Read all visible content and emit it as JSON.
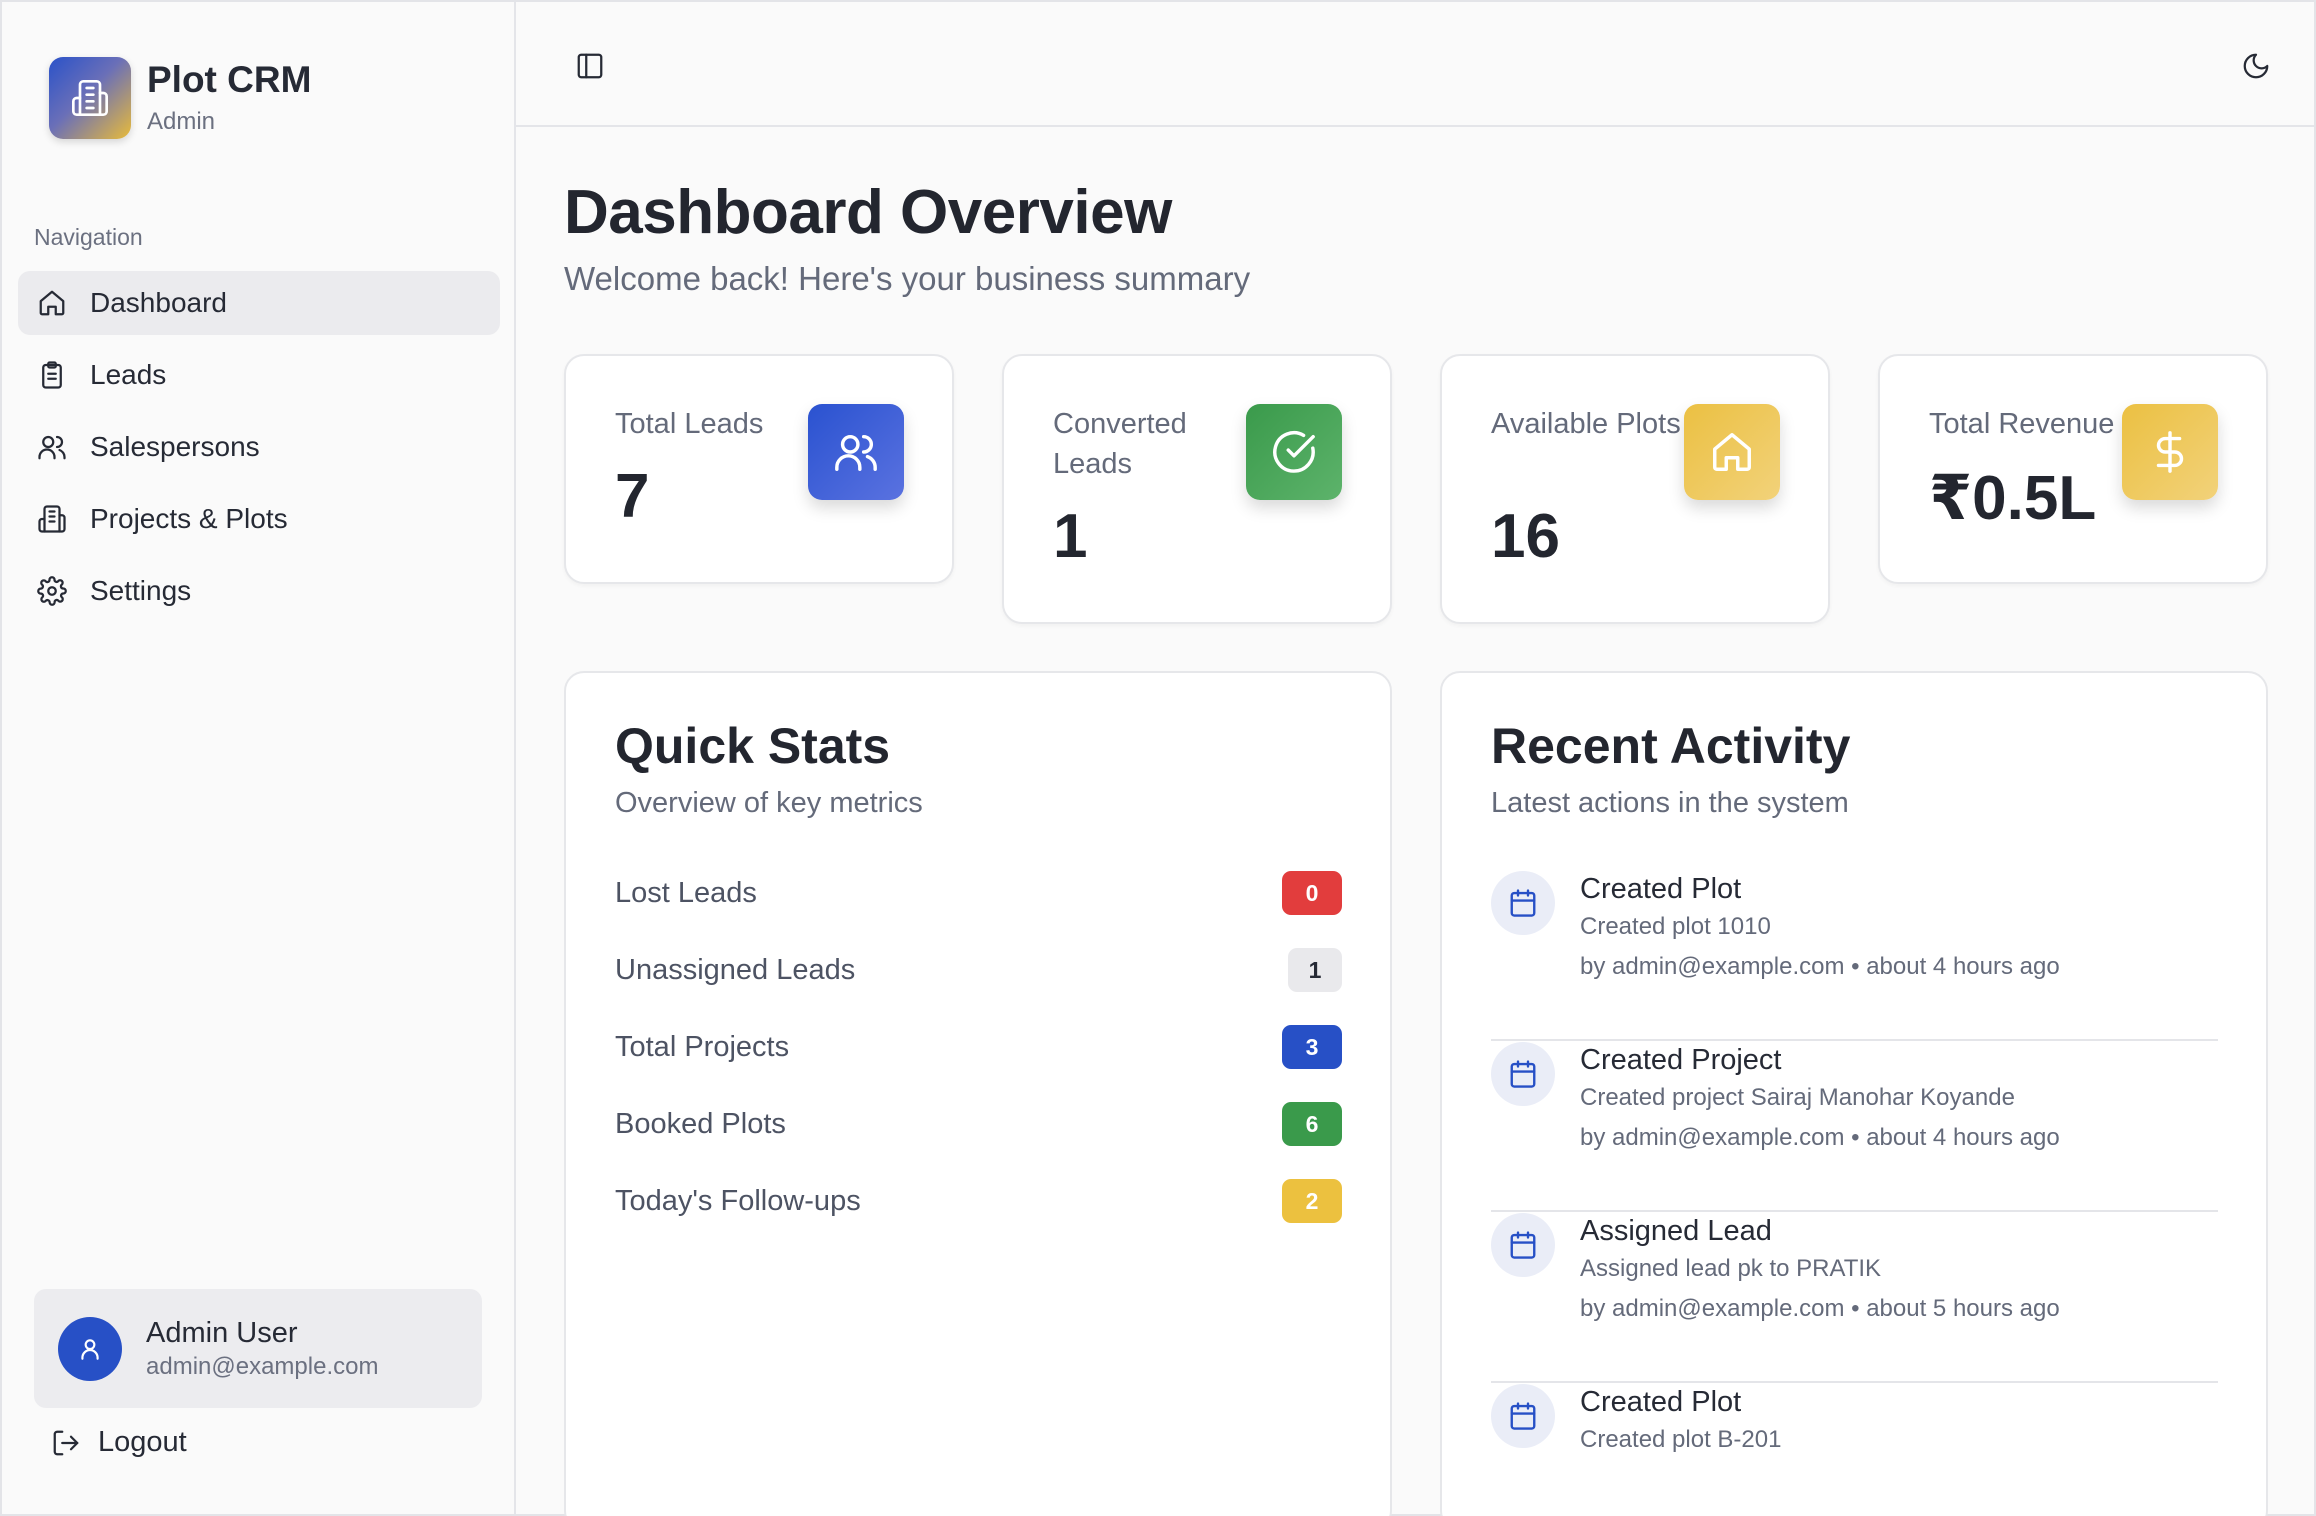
{
  "brand": {
    "title": "Plot CRM",
    "subtitle": "Admin"
  },
  "nav": {
    "heading": "Navigation",
    "items": [
      {
        "label": "Dashboard",
        "icon": "home-icon",
        "active": true
      },
      {
        "label": "Leads",
        "icon": "clipboard-icon",
        "active": false
      },
      {
        "label": "Salespersons",
        "icon": "users-icon",
        "active": false
      },
      {
        "label": "Projects & Plots",
        "icon": "building-icon",
        "active": false
      },
      {
        "label": "Settings",
        "icon": "gear-icon",
        "active": false
      }
    ]
  },
  "user": {
    "name": "Admin User",
    "email": "admin@example.com"
  },
  "logout_label": "Logout",
  "page": {
    "title": "Dashboard Overview",
    "subtitle": "Welcome back! Here's your business summary"
  },
  "stats": [
    {
      "label": "Total Leads",
      "value": "7",
      "icon": "users-icon",
      "color": "#3358d4"
    },
    {
      "label": "Converted Leads",
      "value": "1",
      "icon": "check-circle-icon",
      "color": "#3f9a4f"
    },
    {
      "label": "Available Plots",
      "value": "16",
      "icon": "home-icon",
      "color": "#edc24a"
    },
    {
      "label": "Total Revenue",
      "value": "₹0.5L",
      "icon": "dollar-icon",
      "color": "#edc24a"
    }
  ],
  "quick_stats": {
    "title": "Quick Stats",
    "subtitle": "Overview of key metrics",
    "rows": [
      {
        "label": "Lost Leads",
        "value": "0",
        "bg": "#e23d3d",
        "fg": "#ffffff"
      },
      {
        "label": "Unassigned Leads",
        "value": "1",
        "bg": "#e9e9ec",
        "fg": "#262a35"
      },
      {
        "label": "Total Projects",
        "value": "3",
        "bg": "#2750c6",
        "fg": "#ffffff"
      },
      {
        "label": "Booked Plots",
        "value": "6",
        "bg": "#3a9a4b",
        "fg": "#ffffff"
      },
      {
        "label": "Today's Follow-ups",
        "value": "2",
        "bg": "#ecc13f",
        "fg": "#ffffff"
      }
    ]
  },
  "recent_activity": {
    "title": "Recent Activity",
    "subtitle": "Latest actions in the system",
    "items": [
      {
        "title": "Created Plot",
        "desc": "Created plot 1010",
        "meta": "by admin@example.com • about 4 hours ago"
      },
      {
        "title": "Created Project",
        "desc": "Created project Sairaj Manohar Koyande",
        "meta": "by admin@example.com • about 4 hours ago"
      },
      {
        "title": "Assigned Lead",
        "desc": "Assigned lead pk to PRATIK",
        "meta": "by admin@example.com • about 5 hours ago"
      },
      {
        "title": "Created Plot",
        "desc": "Created plot B-201",
        "meta": ""
      }
    ]
  }
}
